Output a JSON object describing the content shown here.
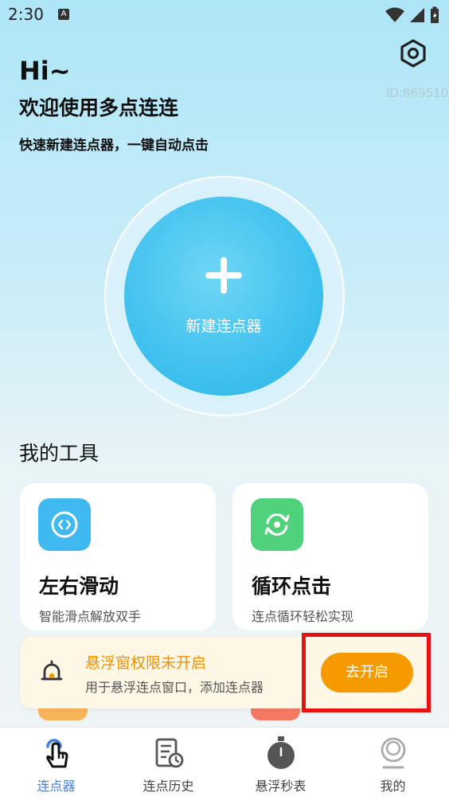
{
  "status_bar": {
    "time": "2:30",
    "notification_letter": "A"
  },
  "header": {
    "greeting": "Hi~",
    "welcome": "欢迎使用多点连连",
    "user_id": "ID:869510",
    "subtitle": "快速新建连点器，一键自动点击"
  },
  "main_action": {
    "label": "新建连点器"
  },
  "tools": {
    "title": "我的工具",
    "items": [
      {
        "title": "左右滑动",
        "desc": "智能滑点解放双手",
        "icon": "swipe-icon",
        "color": "#3fb9f0"
      },
      {
        "title": "循环点击",
        "desc": "连点循环轻松实现",
        "icon": "loop-click-icon",
        "color": "#4fd27b"
      }
    ]
  },
  "permission_banner": {
    "title": "悬浮窗权限未开启",
    "desc": "用于悬浮连点窗口，添加连点器",
    "button": "去开启",
    "icon": "bell-icon"
  },
  "bottom_nav": {
    "active_index": 0,
    "items": [
      {
        "label": "连点器",
        "icon": "tap-hand-icon"
      },
      {
        "label": "连点历史",
        "icon": "history-doc-icon"
      },
      {
        "label": "悬浮秒表",
        "icon": "stopwatch-icon"
      },
      {
        "label": "我的",
        "icon": "profile-icon"
      }
    ]
  },
  "colors": {
    "accent_blue": "#3c7fe2",
    "primary_circle": "#40c1ee",
    "warning_orange": "#f59b00",
    "highlight_red": "#e81212"
  }
}
